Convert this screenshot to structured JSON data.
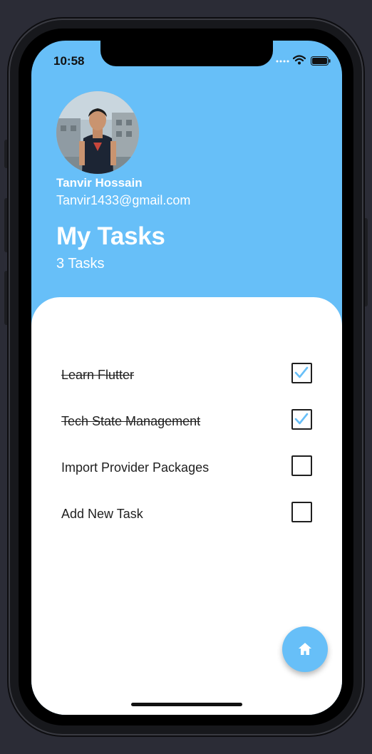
{
  "status_bar": {
    "time": "10:58"
  },
  "profile": {
    "name": "Tanvir Hossain",
    "email": "Tanvir1433@gmail.com"
  },
  "header": {
    "title": "My Tasks",
    "task_count": "3 Tasks"
  },
  "tasks": [
    {
      "label": "Learn Flutter",
      "done": true
    },
    {
      "label": "Tech State Management",
      "done": true
    },
    {
      "label": "Import Provider Packages",
      "done": false
    },
    {
      "label": "Add New Task",
      "done": false
    }
  ],
  "fab": {
    "icon": "home-icon"
  },
  "colors": {
    "accent": "#67bff8",
    "check": "#67bff8",
    "background": "#2b2c36"
  }
}
